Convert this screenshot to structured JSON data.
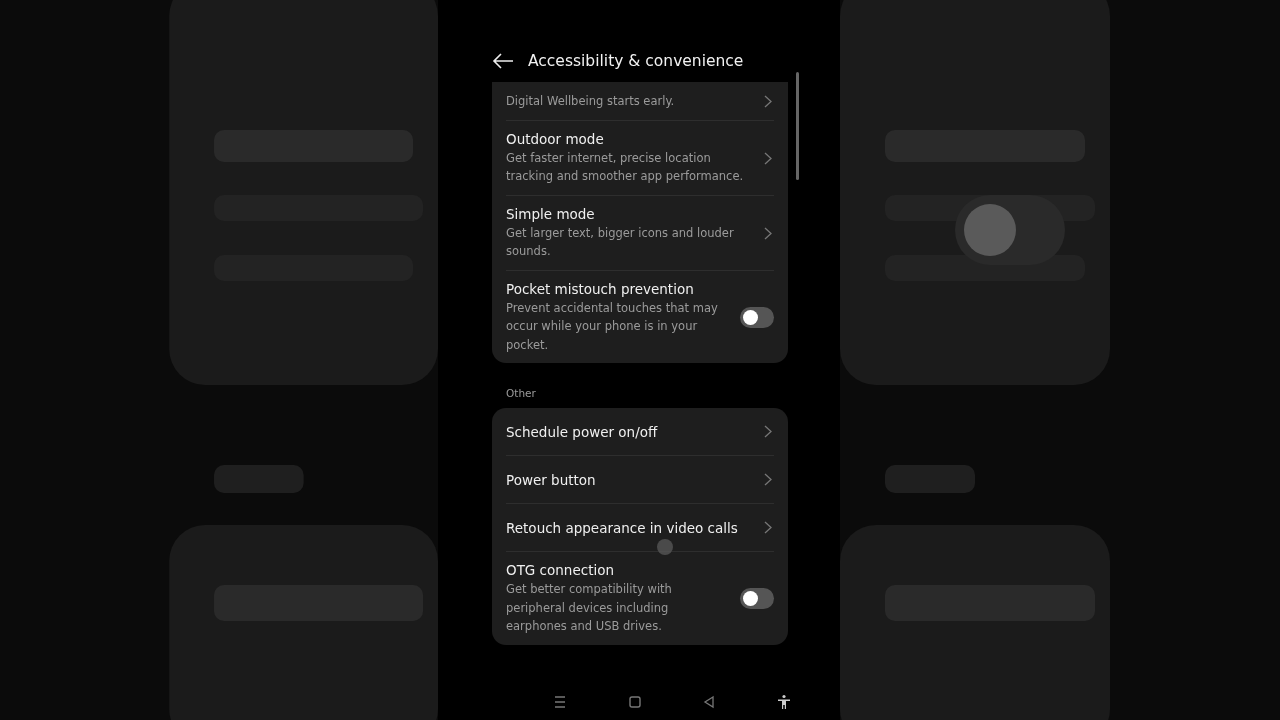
{
  "header": {
    "title": "Accessibility & convenience"
  },
  "sections": [
    {
      "items": [
        {
          "kind": "link",
          "description": "Digital Wellbeing starts early."
        },
        {
          "kind": "link",
          "title": "Outdoor mode",
          "description": "Get faster internet, precise location tracking and smoother app performance."
        },
        {
          "kind": "link",
          "title": "Simple mode",
          "description": "Get larger text, bigger icons and louder sounds."
        },
        {
          "kind": "toggle",
          "title": "Pocket mistouch prevention",
          "description": "Prevent accidental touches that may occur while your phone is in your pocket.",
          "on": false
        }
      ]
    },
    {
      "label": "Other",
      "items": [
        {
          "kind": "link",
          "title": "Schedule power on/off"
        },
        {
          "kind": "link",
          "title": "Power button"
        },
        {
          "kind": "link",
          "title": "Retouch appearance in video calls"
        },
        {
          "kind": "toggle",
          "title": "OTG connection",
          "description": "Get better compatibility with peripheral devices including earphones and USB drives.",
          "on": false
        }
      ]
    }
  ]
}
